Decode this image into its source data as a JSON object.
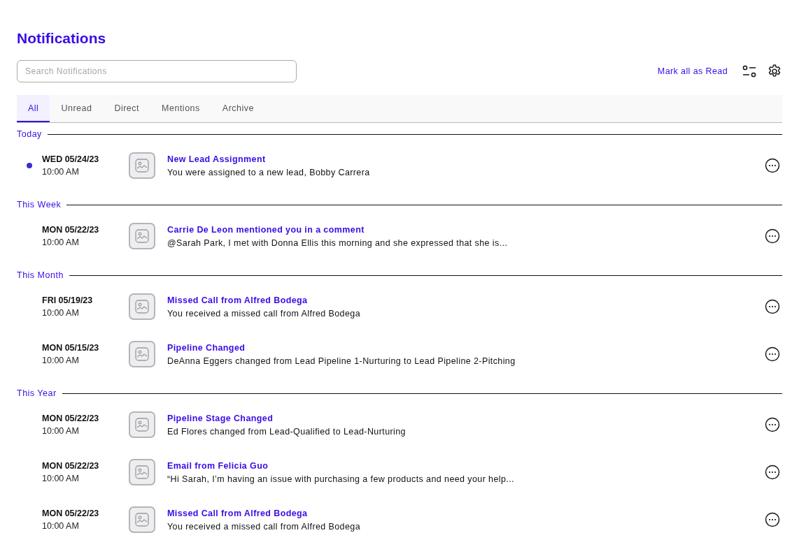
{
  "page": {
    "title": "Notifications"
  },
  "search": {
    "placeholder": "Search Notifications"
  },
  "mark_all_link": "Mark all as Read",
  "tabs": [
    {
      "label": "All",
      "selected": true
    },
    {
      "label": "Unread",
      "selected": false
    },
    {
      "label": "Direct",
      "selected": false
    },
    {
      "label": "Mentions",
      "selected": false
    },
    {
      "label": "Archive",
      "selected": false
    }
  ],
  "sections": [
    {
      "heading": "Today",
      "items": [
        {
          "date": "WED 05/24/23",
          "time": "10:00 AM",
          "title": "New Lead Assignment",
          "message": "You were assigned to a new lead, Bobby Carrera",
          "unread": true
        }
      ]
    },
    {
      "heading": "This Week",
      "items": [
        {
          "date": "MON 05/22/23",
          "time": "10:00 AM",
          "title": "Carrie De Leon mentioned you in a comment",
          "message": "@Sarah Park, I met with Donna Ellis this morning and she expressed that she is...",
          "unread": false
        }
      ]
    },
    {
      "heading": "This Month",
      "items": [
        {
          "date": "FRI 05/19/23",
          "time": "10:00 AM",
          "title": "Missed Call from Alfred Bodega",
          "message": "You received a missed call from Alfred Bodega",
          "unread": false
        },
        {
          "date": "MON 05/15/23",
          "time": "10:00 AM",
          "title": "Pipeline Changed",
          "message": "DeAnna Eggers changed from Lead Pipeline 1-Nurturing to Lead Pipeline 2-Pitching",
          "unread": false
        }
      ]
    },
    {
      "heading": "This Year",
      "items": [
        {
          "date": "MON 05/22/23",
          "time": "10:00 AM",
          "title": "Pipeline Stage Changed",
          "message": "Ed Flores changed from Lead-Qualified to Lead-Nurturing",
          "unread": false
        },
        {
          "date": "MON 05/22/23",
          "time": "10:00 AM",
          "title": "Email from Felicia Guo",
          "message": "“Hi Sarah, I’m having an issue with purchasing a few products and need your help...",
          "unread": false
        },
        {
          "date": "MON 05/22/23",
          "time": "10:00 AM",
          "title": "Missed Call from Alfred Bodega",
          "message": "You received a missed call from Alfred Bodega",
          "unread": false
        }
      ]
    }
  ]
}
